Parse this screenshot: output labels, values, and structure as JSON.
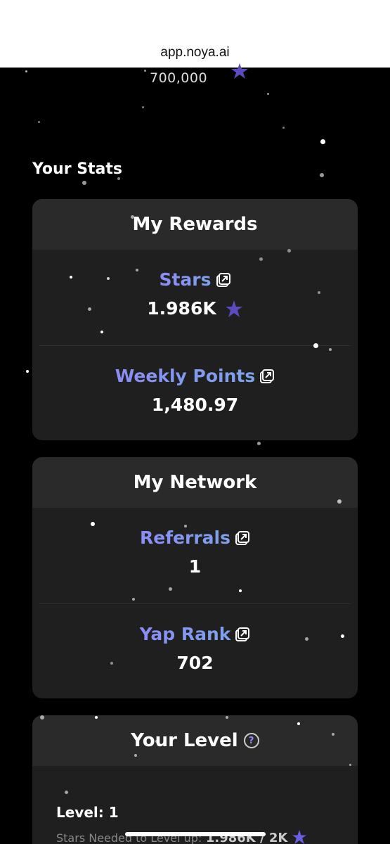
{
  "browser": {
    "url": "app.noya.ai"
  },
  "top": {
    "value": "700,000"
  },
  "stats_section": {
    "title": "Your Stats"
  },
  "rewards_card": {
    "title": "My Rewards",
    "stars_label": "Stars",
    "stars_value": "1.986K",
    "weekly_label": "Weekly Points",
    "weekly_value": "1,480.97"
  },
  "network_card": {
    "title": "My Network",
    "referrals_label": "Referrals",
    "referrals_value": "1",
    "yap_label": "Yap Rank",
    "yap_value": "702"
  },
  "level_card": {
    "title": "Your Level",
    "help_glyph": "?",
    "level_text": "Level: 1",
    "needed_label": "Stars Needed to Level up:",
    "needed_value": "1.986K / 2K"
  },
  "colors": {
    "accent_start": "#8b8df5",
    "accent_end": "#7aa6e8",
    "star_purple": "#5b4bbf",
    "card_bg": "#1f1f1f",
    "card_header_bg": "#2a2a2a"
  },
  "icons": [
    "external-link-icon",
    "star-icon",
    "help-icon"
  ]
}
